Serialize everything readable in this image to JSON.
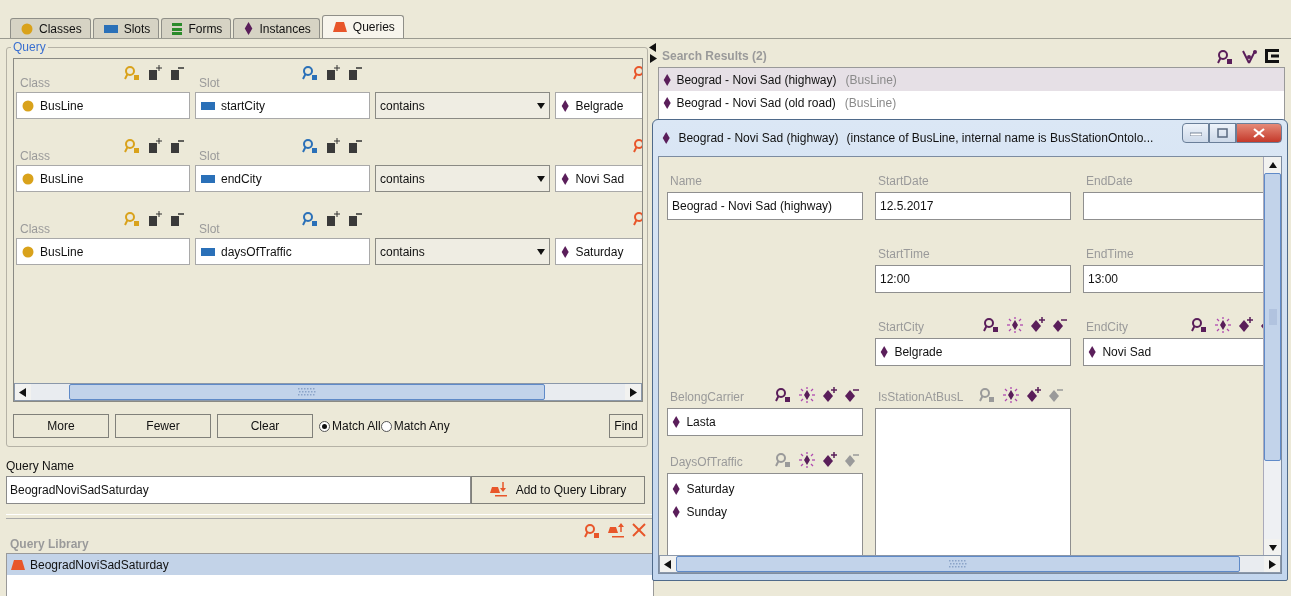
{
  "tabs": [
    {
      "label": "Classes",
      "kind": "class",
      "selected": false
    },
    {
      "label": "Slots",
      "kind": "slot",
      "selected": false
    },
    {
      "label": "Forms",
      "kind": "form",
      "selected": false
    },
    {
      "label": "Instances",
      "kind": "instance",
      "selected": false
    },
    {
      "label": "Queries",
      "kind": "query",
      "selected": true
    }
  ],
  "query": {
    "title": "Query",
    "rows": [
      {
        "class_label": "Class",
        "class_value": "BusLine",
        "slot_label": "Slot",
        "slot_value": "startCity",
        "operator": "contains",
        "value": "Belgrade"
      },
      {
        "class_label": "Class",
        "class_value": "BusLine",
        "slot_label": "Slot",
        "slot_value": "endCity",
        "operator": "contains",
        "value": "Novi Sad"
      },
      {
        "class_label": "Class",
        "class_value": "BusLine",
        "slot_label": "Slot",
        "slot_value": "daysOfTraffic",
        "operator": "contains",
        "value": "Saturday"
      }
    ],
    "buttons": [
      "More",
      "Fewer",
      "Clear"
    ],
    "match_options": [
      {
        "label": "Match All",
        "selected": true
      },
      {
        "label": "Match Any",
        "selected": false
      }
    ],
    "find_button": "Find"
  },
  "query_name": {
    "label": "Query Name",
    "value": "BeogradNoviSadSaturday",
    "add_button": "Add to Query Library"
  },
  "query_library": {
    "title": "Query Library",
    "items": [
      {
        "label": "BeogradNoviSadSaturday",
        "selected": true
      }
    ]
  },
  "search_results": {
    "title": "Search Results (2)",
    "items": [
      {
        "label": "Beograd - Novi Sad (highway)",
        "type": "(BusLine)",
        "selected": true
      },
      {
        "label": "Beograd - Novi Sad (old road)",
        "type": "(BusLine)",
        "selected": false
      }
    ]
  },
  "instance_window": {
    "title": "Beograd - Novi Sad (highway)",
    "subtitle": "(instance of BusLine, internal name is BusStationOntolo...",
    "columns": [
      [
        {
          "kind": "text",
          "label": "Name",
          "value": "Beograd - Novi Sad (highway)"
        },
        {
          "kind": "instance",
          "label": "BelongCarrier",
          "values": [
            "Lasta"
          ],
          "find_enabled": true,
          "remove_enabled": true
        },
        {
          "kind": "list",
          "label": "DaysOfTraffic",
          "values": [
            "Saturday",
            "Sunday"
          ],
          "find_enabled": false,
          "remove_enabled": false
        }
      ],
      [
        {
          "kind": "text",
          "label": "StartDate",
          "value": "12.5.2017"
        },
        {
          "kind": "text",
          "label": "StartTime",
          "value": "12:00"
        },
        {
          "kind": "instance",
          "label": "StartCity",
          "values": [
            "Belgrade"
          ],
          "find_enabled": true,
          "remove_enabled": true
        },
        {
          "kind": "tall_list",
          "label": "IsStationAtBusL",
          "find_enabled": false,
          "remove_enabled": false
        }
      ],
      [
        {
          "kind": "text",
          "label": "EndDate"
        },
        {
          "kind": "text",
          "label": "EndTime",
          "value": "13:00"
        },
        {
          "kind": "instance",
          "label": "EndCity",
          "values": [
            "Novi Sad"
          ],
          "find_enabled": true,
          "remove_enabled": true
        }
      ]
    ]
  }
}
